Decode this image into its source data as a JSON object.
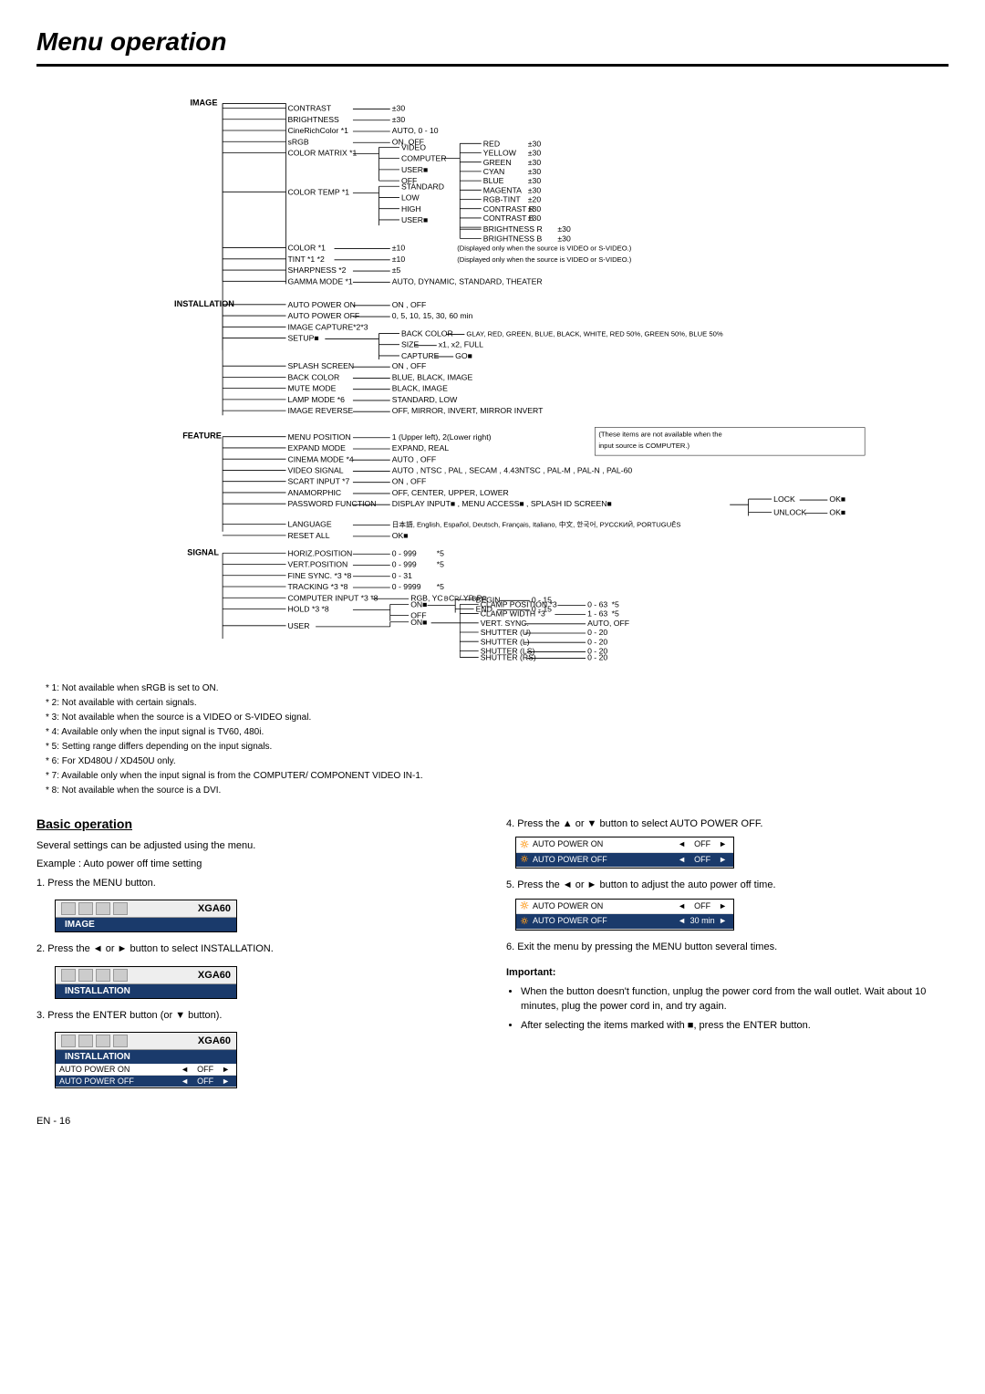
{
  "page": {
    "title": "Menu operation",
    "page_number": "EN - 16"
  },
  "footnotes": [
    "* 1: Not available when sRGB is set to ON.",
    "* 2: Not available with certain signals.",
    "* 3: Not available when the source is a VIDEO or S-VIDEO signal.",
    "* 4: Available only when the input signal is TV60, 480i.",
    "* 5: Setting range differs depending on the input signals.",
    "* 6: For XD480U / XD450U only.",
    "* 7: Available only when the input signal is from the COMPUTER/ COMPONENT VIDEO IN-1.",
    "* 8: Not available when the source is a DVI."
  ],
  "basic_operation": {
    "title": "Basic operation",
    "description1": "Several settings can be adjusted using the menu.",
    "description2": "Example : Auto power off time setting",
    "steps": [
      "Press the MENU button.",
      "Press the ◄ or ► button to select INSTALLATION.",
      "Press the ENTER button (or ▼ button).",
      "Press the ▲ or ▼ button to select AUTO POWER OFF.",
      "Press the ◄ or ► button to adjust the auto power off time.",
      "Exit the menu by pressing the MENU button several times."
    ],
    "menus": [
      {
        "brand": "XGA60",
        "tab": "IMAGE"
      },
      {
        "brand": "XGA60",
        "tab": "INSTALLATION"
      },
      {
        "brand": "XGA60",
        "tab": "INSTALLATION",
        "rows": [
          {
            "label": "AUTO POWER ON",
            "val": "OFF",
            "highlight": false
          },
          {
            "label": "AUTO POWER OFF",
            "val": "OFF",
            "highlight": true
          }
        ]
      }
    ],
    "auto_power_menus": [
      {
        "label": "AUTO POWER ON",
        "val": "OFF"
      },
      {
        "label": "AUTO POWER OFF",
        "val": "OFF"
      }
    ],
    "auto_power_menus2": [
      {
        "label": "AUTO POWER ON",
        "val": "OFF"
      },
      {
        "label": "AUTO POWER OFF",
        "val": "30 min"
      }
    ],
    "important_title": "Important:",
    "important_bullets": [
      "When the button doesn't function,  unplug the power cord from the wall outlet. Wait about 10 minutes, plug the power cord in, and try again.",
      "After selecting the items marked with ■, press the ENTER button."
    ]
  },
  "diagram": {
    "main_sections": [
      "IMAGE",
      "INSTALLATION",
      "FEATURE",
      "SIGNAL"
    ],
    "image_items": [
      {
        "name": "CONTRAST",
        "value": "±30"
      },
      {
        "name": "BRIGHTNESS",
        "value": "±30"
      },
      {
        "name": "CineRichColor *1",
        "value": "AUTO, 0 - 10"
      },
      {
        "name": "sRGB",
        "value": "ON, OFF"
      },
      {
        "name": "COLOR MATRIX *1",
        "sub": [
          "VIDEO",
          "COMPUTER",
          "USER■",
          "OFF"
        ]
      },
      {
        "name": "COLOR TEMP *1",
        "sub": [
          "STANDARD",
          "LOW",
          "HIGH",
          "USER■"
        ]
      },
      {
        "name": "COLOR *1",
        "value": "±10"
      },
      {
        "name": "TINT *1 *2",
        "value": "±10"
      },
      {
        "name": "SHARPNESS *2",
        "value": "±5"
      },
      {
        "name": "GAMMA MODE *1",
        "value": "AUTO, DYNAMIC, STANDARD, THEATER"
      }
    ],
    "color_matrix_sub": [
      "RED ±30",
      "YELLOW ±30",
      "GREEN ±30",
      "CYAN ±30",
      "BLUE ±30",
      "MAGENTA ±30",
      "RGB-TINT ±20",
      "CONTRAST R ±30",
      "CONTRAST B ±30",
      "BRIGHTNESS R ±30",
      "BRIGHTNESS B ±30"
    ],
    "color_temp_sub": [
      "STANDARD",
      "LOW",
      "HIGH",
      "USER■"
    ],
    "installation_items": [
      "AUTO POWER ON → ON, OFF",
      "AUTO POWER OFF → 0, 5, 10, 15, 30, 60 min",
      "IMAGE CAPTURE*2*3",
      "SETUP■ → BACK COLOR (GLAY,RED,GREEN,BLUE,BLACK,WHITE,RED 50%,GREEN 50%,BLUE 50%), SIZE (x1,x2,FULL), CAPTURE (GO■)",
      "SPLASH SCREEN → ON, OFF",
      "BACK COLOR → BLUE, BLACK, IMAGE",
      "MUTE MODE → BLACK, IMAGE",
      "LAMP MODE *6 → STANDARD, LOW",
      "IMAGE REVERSE → OFF, MIRROR, INVERT, MIRROR INVERT"
    ],
    "feature_items": [
      "MENU POSITION → 1(Upper left), 2(Lower right)",
      "EXPAND MODE → EXPAND, REAL",
      "CINEMA MODE *4 → AUTO, OFF",
      "VIDEO SIGNAL → AUTO, NTSC, PAL, SECAM, 4.43NTSC, PAL-M, PAL-N, PAL-60",
      "SCART INPUT *7 → ON, OFF",
      "ANAMORPHIC → OFF, CENTER, UPPER, LOWER",
      "PASSWORD FUNCTION → DISPLAY INPUT■, MENU ACCESS■, SPLASH ID SCREEN■ → LOCK (OK■), UNLOCK (OK■)"
    ],
    "signal_items": [
      "LANGUAGE → 日本語, English, Español, Deutsch, Français, Italiano, 中文, 한국어, РУССКИЙ, PORTUGUÊS",
      "RESET ALL → OK■",
      "HORIZ.POSITION 0-999 *5",
      "VERT.POSITION 0-999 *5",
      "FINE SYNC. *3*8 0-31",
      "TRACKING *3*8 0-9999 *5",
      "COMPUTER INPUT *3*8 → RGB, YCbCr/YPbPr",
      "HOLD *3*8 → ON■ (BEGIN 0-15, END 0-15), OFF",
      "USER → ON■ → CLAMP POSITION *3 0-63 *5, CLAMP WIDTH *3 1-63 *5, VERT.SYNC. AUTO/OFF, SHUTTER(U) 0-20, SHUTTER(L) 0-20, SHUTTER(LS) 0-20, SHUTTER(RS) 0-20"
    ],
    "note_computer": "These items are not available when the input source is COMPUTER.)"
  }
}
